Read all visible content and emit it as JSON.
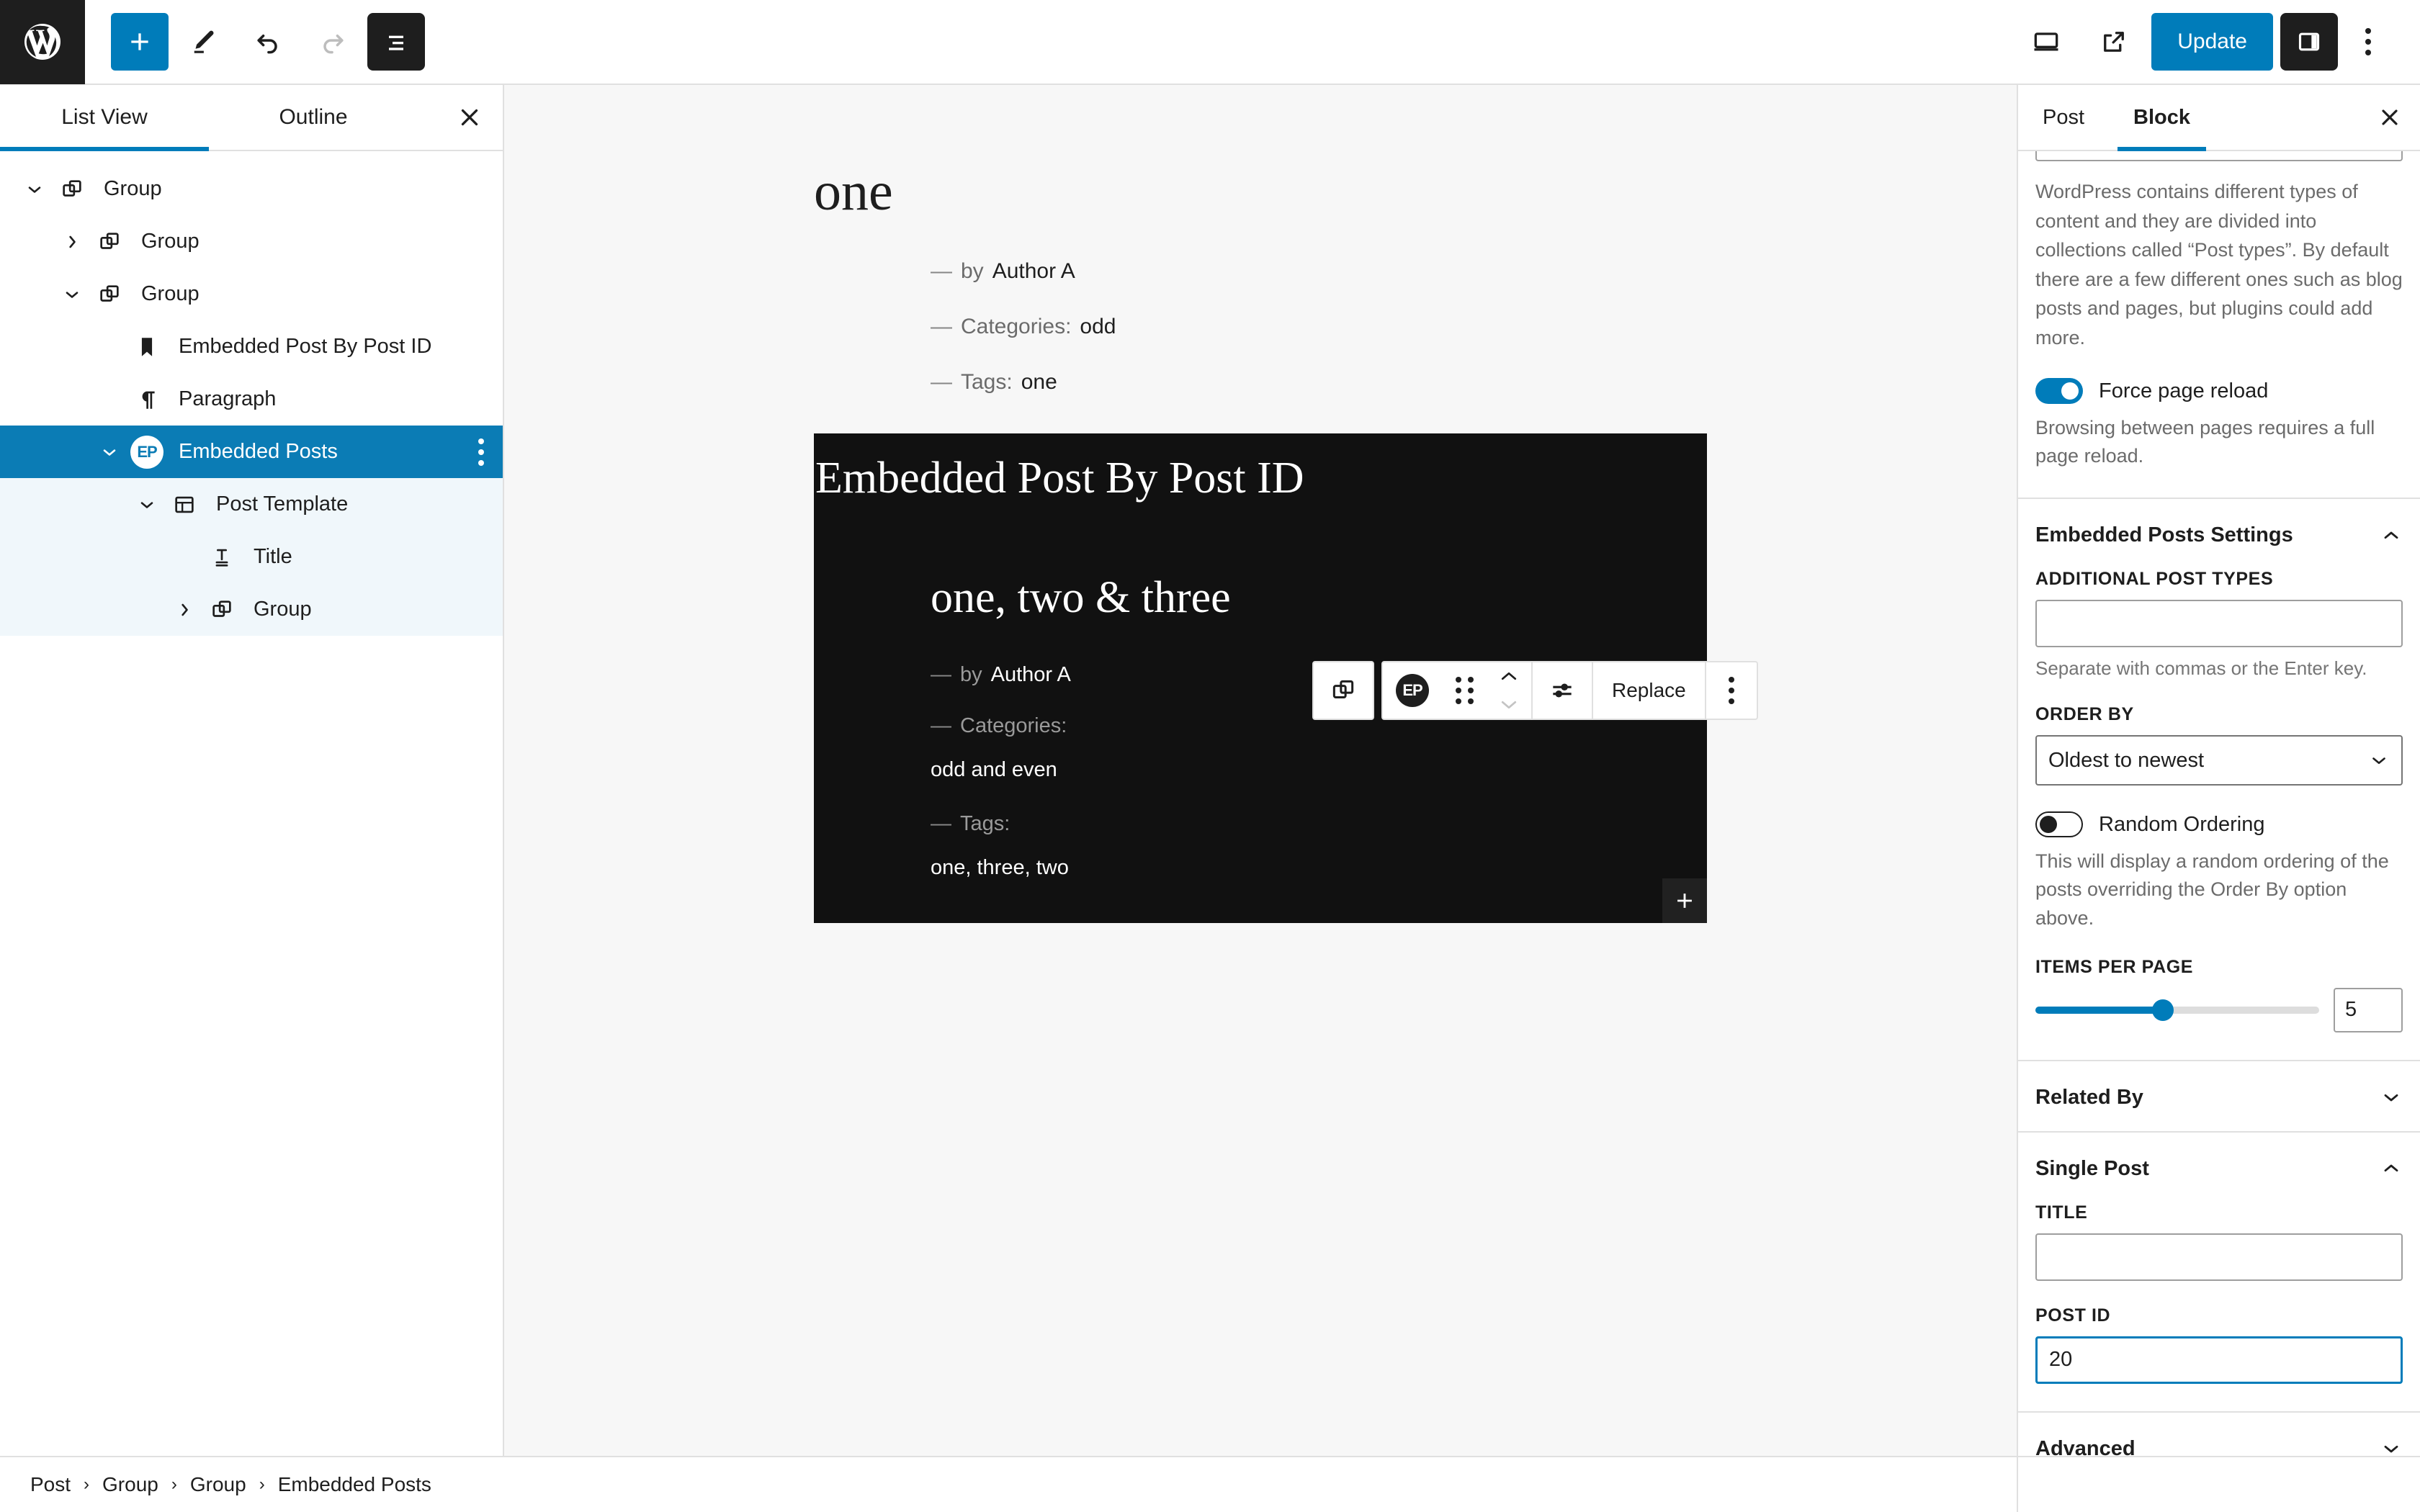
{
  "topbar": {
    "wp_logo": "wordpress-logo",
    "add_block_label": "+",
    "tools": [
      "add-block",
      "edit-pencil",
      "undo",
      "redo",
      "list-view"
    ],
    "view_desktop": "desktop-icon",
    "preview": "external-link-icon",
    "update_label": "Update",
    "settings_toggle": "sidebar-toggle-icon",
    "options": "kebab-menu-icon"
  },
  "listview": {
    "tabs": [
      {
        "label": "List View",
        "active": true
      },
      {
        "label": "Outline",
        "active": false
      }
    ],
    "close": "close-icon",
    "rows": [
      {
        "label": "Group",
        "icon": "group-icon",
        "depth": 0,
        "chevron": "down",
        "state": "normal"
      },
      {
        "label": "Group",
        "icon": "group-icon",
        "depth": 1,
        "chevron": "right",
        "state": "normal"
      },
      {
        "label": "Group",
        "icon": "group-icon",
        "depth": 1,
        "chevron": "down",
        "state": "normal"
      },
      {
        "label": "Embedded Post By Post ID",
        "icon": "bookmark-icon",
        "depth": 2,
        "chevron": "none",
        "state": "normal"
      },
      {
        "label": "Paragraph",
        "icon": "paragraph-icon",
        "depth": 2,
        "chevron": "none",
        "state": "normal"
      },
      {
        "label": "Embedded Posts",
        "icon": "ep-badge-icon",
        "depth": 2,
        "chevron": "down",
        "state": "selected"
      },
      {
        "label": "Post Template",
        "icon": "post-template-icon",
        "depth": 3,
        "chevron": "down",
        "state": "childsel"
      },
      {
        "label": "Title",
        "icon": "title-icon",
        "depth": 4,
        "chevron": "none",
        "state": "childsel"
      },
      {
        "label": "Group",
        "icon": "group-icon",
        "depth": 4,
        "chevron": "right",
        "state": "childsel"
      }
    ]
  },
  "canvas": {
    "post_title": "one",
    "meta": [
      {
        "dash": "—",
        "key": "by",
        "value": "Author A"
      },
      {
        "dash": "—",
        "key": "Categories:",
        "value": "odd"
      },
      {
        "dash": "—",
        "key": "Tags:",
        "value": "one"
      }
    ],
    "block_toolbar": {
      "select_parent": "group-icon",
      "block_type": "EP",
      "drag_handle": "drag-dots-icon",
      "move_up": "chevron-up-icon",
      "move_down": "chevron-down-icon",
      "settings": "sliders-icon",
      "replace_label": "Replace",
      "options": "kebab-menu-icon"
    },
    "embed": {
      "heading": "Embedded Post By Post ID",
      "title": "one, two & three",
      "meta": [
        {
          "dash": "—",
          "key": "by",
          "value": "Author A",
          "inline": true
        },
        {
          "dash": "—",
          "key": "Categories:",
          "value": "odd and even",
          "inline": false
        },
        {
          "dash": "—",
          "key": "Tags:",
          "value": "one, three, two",
          "inline": false
        }
      ],
      "add_block": "+"
    }
  },
  "sidebar": {
    "tabs": [
      {
        "label": "Post",
        "active": false
      },
      {
        "label": "Block",
        "active": true
      }
    ],
    "close": "close-icon",
    "post_type_help": "WordPress contains different types of content and they are divided into collections called “Post types”. By default there are a few different ones such as blog posts and pages, but plugins could add more.",
    "force_reload": {
      "label": "Force page reload",
      "state": "on",
      "help": "Browsing between pages requires a full page reload."
    },
    "embedded_posts_settings": {
      "title": "Embedded Posts Settings",
      "expanded": true,
      "additional_post_types": {
        "label": "ADDITIONAL POST TYPES",
        "value": "",
        "help": "Separate with commas or the Enter key."
      },
      "order_by": {
        "label": "ORDER BY",
        "value": "Oldest to newest"
      },
      "random_ordering": {
        "label": "Random Ordering",
        "state": "off",
        "help": "This will display a random ordering of the posts overriding the Order By option above."
      },
      "items_per_page": {
        "label": "ITEMS PER PAGE",
        "value": "5",
        "percent": 45
      }
    },
    "related_by": {
      "title": "Related By",
      "expanded": false
    },
    "single_post": {
      "title": "Single Post",
      "expanded": true,
      "title_field": {
        "label": "TITLE",
        "value": ""
      },
      "post_id_field": {
        "label": "POST ID",
        "value": "20",
        "focused": true
      }
    },
    "advanced": {
      "title": "Advanced",
      "expanded": false
    }
  },
  "footer": {
    "breadcrumbs": [
      "Post",
      "Group",
      "Group",
      "Embedded Posts"
    ],
    "separator": "›"
  },
  "colors": {
    "accent": "#007cba",
    "selection": "#0b7cb5",
    "child_selection": "#f0f7fb",
    "dark": "#1e1e1e",
    "embed_bg": "#111111",
    "canvas_bg": "#f7f7f7"
  }
}
